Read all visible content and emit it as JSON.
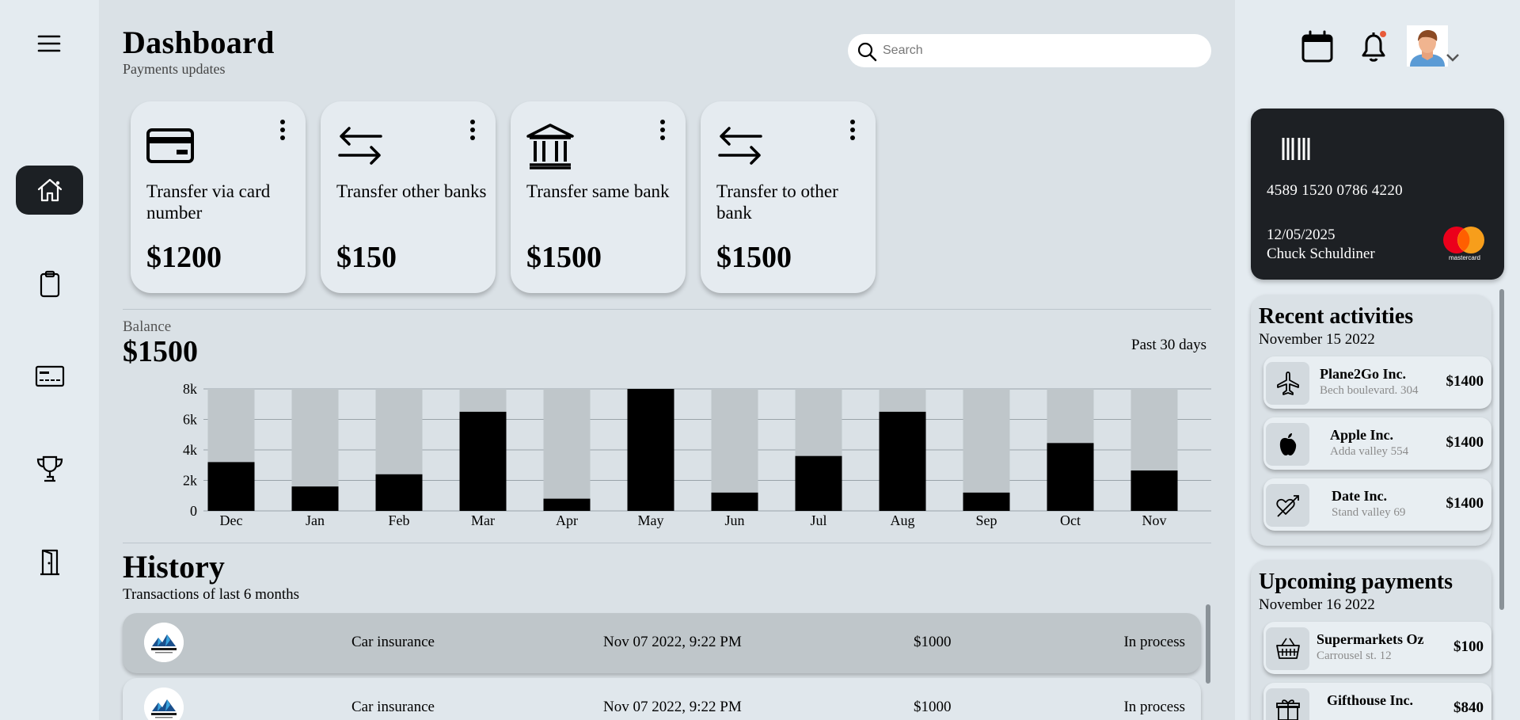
{
  "header": {
    "title": "Dashboard",
    "subtitle": "Payments updates",
    "search_placeholder": "Search"
  },
  "sidebar": {
    "items": [
      {
        "name": "home",
        "icon": "home-icon",
        "active": true
      },
      {
        "name": "clipboard",
        "icon": "clipboard-icon",
        "active": false
      },
      {
        "name": "cards",
        "icon": "credit-card-icon",
        "active": false
      },
      {
        "name": "trophy",
        "icon": "trophy-icon",
        "active": false
      },
      {
        "name": "logout",
        "icon": "door-icon",
        "active": false
      }
    ]
  },
  "transfers": [
    {
      "icon": "credit-card-icon",
      "label": "Transfer via card number",
      "amount": "$1200"
    },
    {
      "icon": "transfer-arrows-icon",
      "label": "Transfer other banks",
      "amount": "$150"
    },
    {
      "icon": "bank-icon",
      "label": "Transfer same bank",
      "amount": "$1500"
    },
    {
      "icon": "transfer-arrows-icon",
      "label": "Transfer to other bank",
      "amount": "$1500"
    }
  ],
  "balance": {
    "label": "Balance",
    "amount": "$1500",
    "period": "Past 30 days"
  },
  "chart_data": {
    "type": "bar",
    "categories": [
      "Dec",
      "Jan",
      "Feb",
      "Mar",
      "Apr",
      "May",
      "Jun",
      "Jul",
      "Aug",
      "Sep",
      "Oct",
      "Nov"
    ],
    "values": [
      3200,
      1600,
      2400,
      6500,
      800,
      8000,
      1200,
      3600,
      6500,
      1200,
      4450,
      2650
    ],
    "max_value": 8000,
    "yticks": [
      "0",
      "2k",
      "4k",
      "6k",
      "8k"
    ],
    "ylim": [
      0,
      8000
    ],
    "bar_color": "#000000",
    "track_color": "#bfc6ca",
    "grid": true
  },
  "history": {
    "title": "History",
    "subtitle": "Transactions of last 6 months",
    "rows": [
      {
        "logo": "company-logo",
        "name": "Car insurance",
        "date": "Nov 07 2022, 9:22 PM",
        "amount": "$1000",
        "status": "In process"
      },
      {
        "logo": "company-logo",
        "name": "Car insurance",
        "date": "Nov 07 2022, 9:22 PM",
        "amount": "$1000",
        "status": "In process"
      }
    ]
  },
  "card": {
    "number": "4589 1520 0786 4220",
    "expiry": "12/05/2025",
    "holder": "Chuck Schuldiner",
    "brand": "mastercard"
  },
  "recent": {
    "title": "Recent activities",
    "date": "November 15 2022",
    "items": [
      {
        "icon": "airplane-icon",
        "name": "Plane2Go Inc.",
        "address": "Bech boulevard. 304",
        "amount": "$1400"
      },
      {
        "icon": "apple-icon",
        "name": "Apple Inc.",
        "address": "Adda valley 554",
        "amount": "$1400"
      },
      {
        "icon": "heart-arrow-icon",
        "name": "Date Inc.",
        "address": "Stand valley 69",
        "amount": "$1400"
      }
    ]
  },
  "upcoming": {
    "title": "Upcoming payments",
    "date": "November 16 2022",
    "items": [
      {
        "icon": "basket-icon",
        "name": "Supermarkets Oz",
        "address": "Carrousel st. 12",
        "amount": "$100"
      },
      {
        "icon": "gift-icon",
        "name": "Gifthouse Inc.",
        "address": "",
        "amount": "$840"
      }
    ]
  },
  "colors": {
    "background": "#dae1e6",
    "panel": "#e4ebf0",
    "dark": "#1d2024",
    "notification": "#e85b3a"
  }
}
